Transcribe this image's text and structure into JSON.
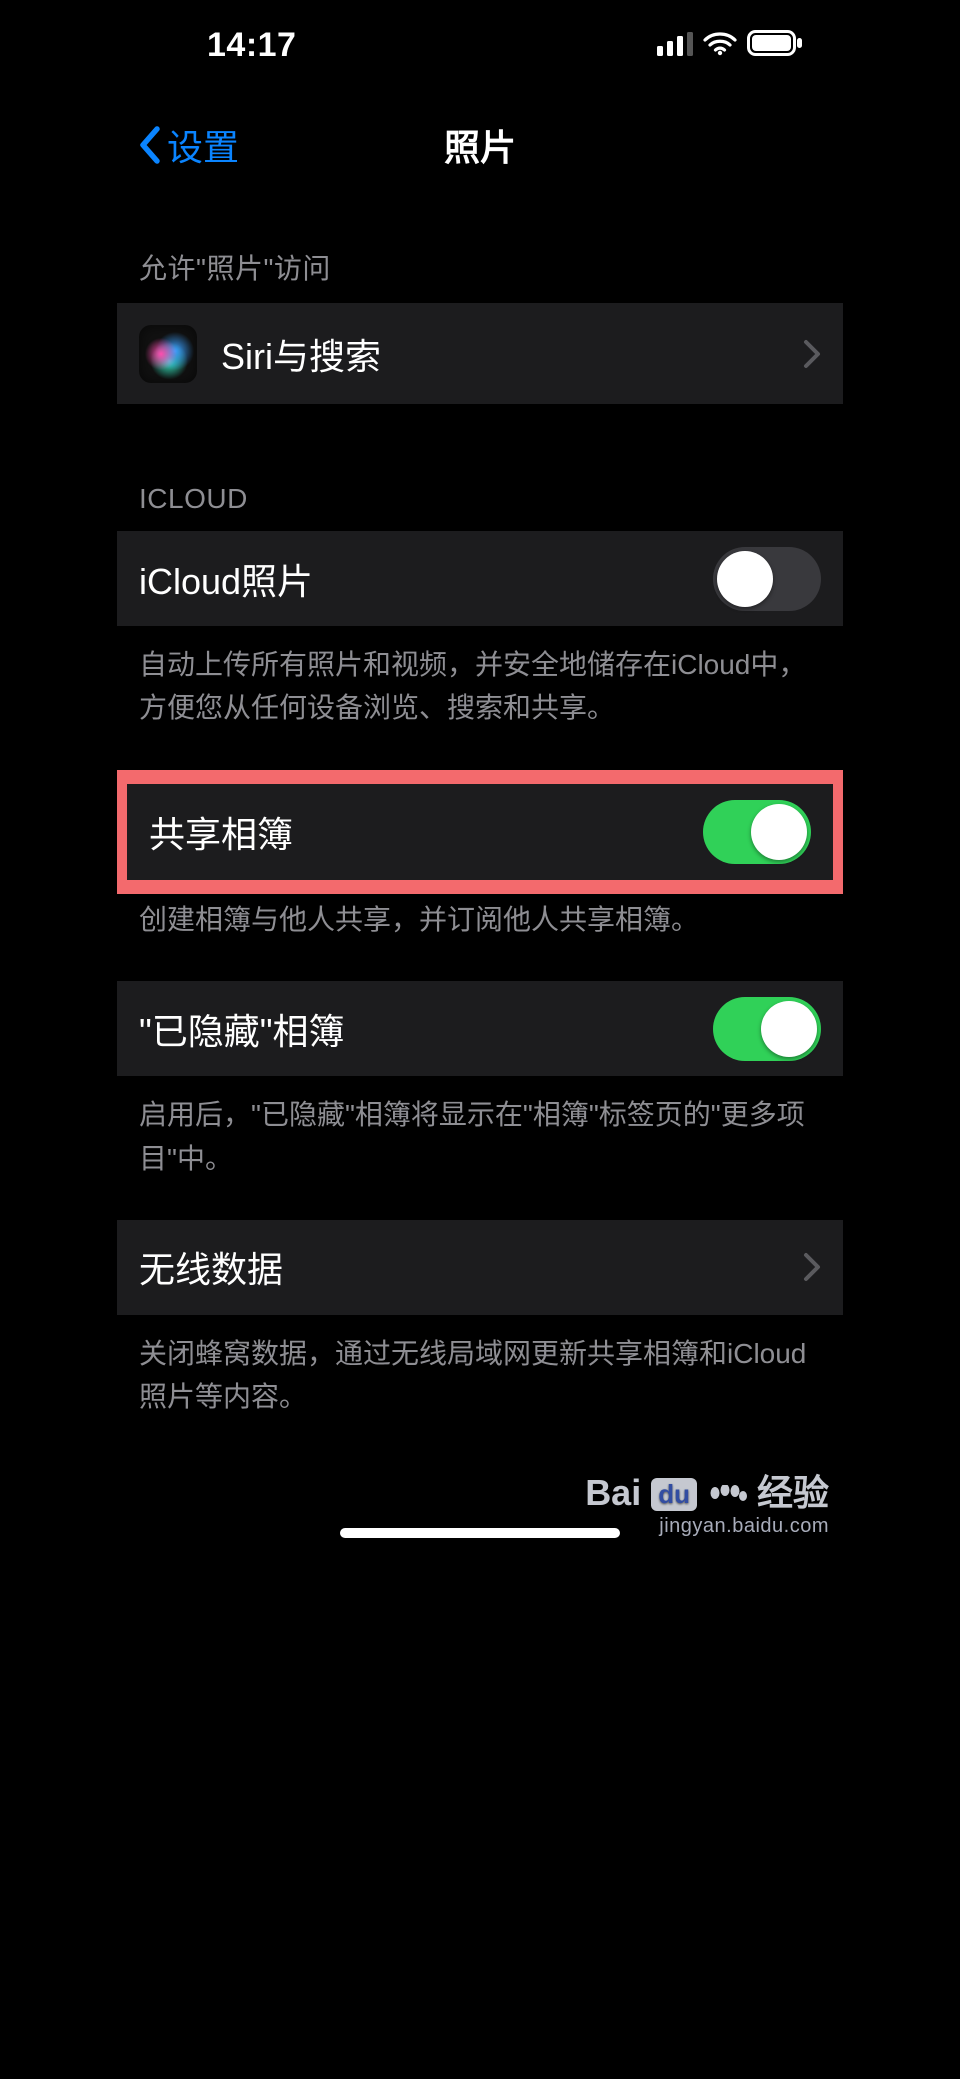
{
  "status": {
    "time": "14:17"
  },
  "nav": {
    "back": "设置",
    "title": "照片"
  },
  "section_allow_header": "允许\"照片\"访问",
  "row_siri": {
    "label": "Siri与搜索"
  },
  "section_icloud_header": "ICLOUD",
  "row_icloud_photos": {
    "label": "iCloud照片",
    "enabled": false,
    "footer": "自动上传所有照片和视频，并安全地储存在iCloud中，方便您从任何设备浏览、搜索和共享。"
  },
  "row_shared_albums": {
    "label": "共享相簿",
    "enabled": true,
    "footer": "创建相簿与他人共享，并订阅他人共享相簿。"
  },
  "row_hidden_album": {
    "label": "\"已隐藏\"相簿",
    "enabled": true,
    "footer": "启用后，\"已隐藏\"相簿将显示在\"相簿\"标签页的\"更多项目\"中。"
  },
  "row_wireless": {
    "label": "无线数据",
    "footer": "关闭蜂窝数据，通过无线局域网更新共享相簿和iCloud照片等内容。"
  },
  "watermark": {
    "brand_a": "Bai",
    "brand_b": "du",
    "brand_c": "经验",
    "url": "jingyan.baidu.com"
  }
}
